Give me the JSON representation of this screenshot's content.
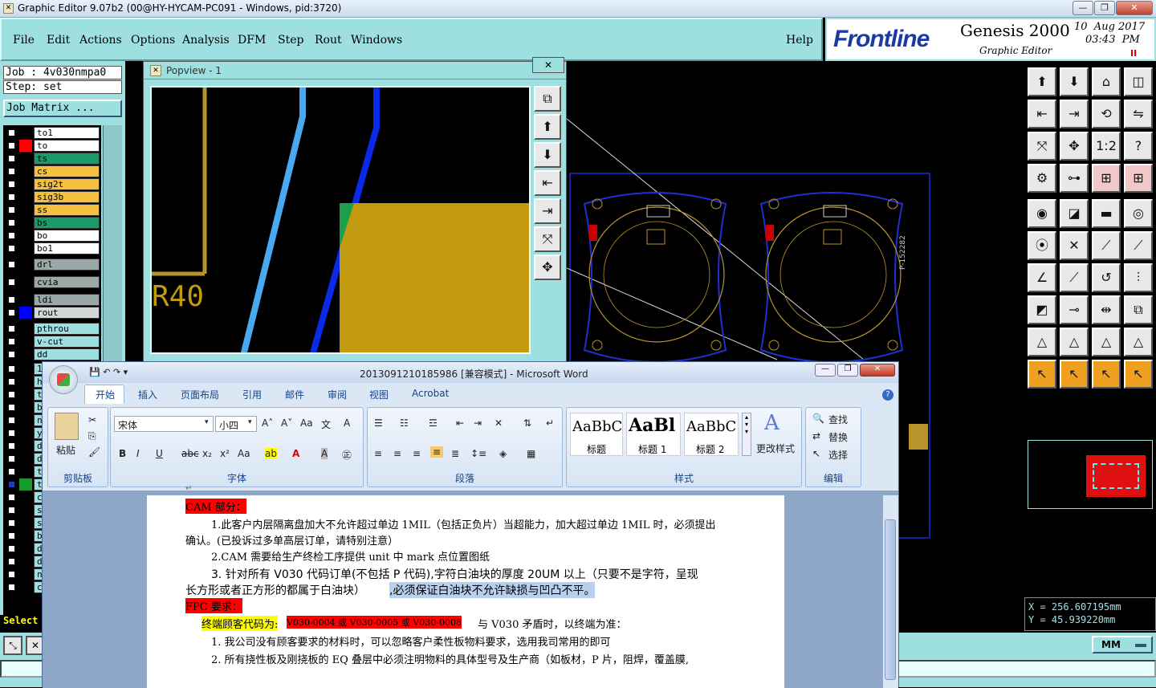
{
  "window": {
    "title": "Graphic Editor 9.07b2 (00@HY-HYCAM-PC091 - Windows, pid:3720)",
    "min": "—",
    "restore": "❐",
    "close": "✕"
  },
  "menu": {
    "items": [
      "File",
      "Edit",
      "Actions",
      "Options",
      "Analysis",
      "DFM",
      "Step",
      "Rout",
      "Windows"
    ],
    "help": "Help"
  },
  "brand": {
    "logo": "Frontline",
    "product": "Genesis 2000",
    "subtitle": "Graphic Editor",
    "date": "10  Aug 2017",
    "time": "03:43  PM",
    "pause": "II"
  },
  "job": {
    "job": "Job : 4v030nmpa0",
    "step": "Step: set",
    "matrix": "Job Matrix ..."
  },
  "layers": [
    {
      "name": "to1",
      "color": "#000000",
      "bg": "#ffffff"
    },
    {
      "name": "to",
      "color": "#ff0000",
      "bg": "#ffffff"
    },
    {
      "name": "ts",
      "color": "#000000",
      "bg": "#1a9a6a"
    },
    {
      "name": "cs",
      "color": "#000000",
      "bg": "#f5c040"
    },
    {
      "name": "sig2t",
      "color": "#000000",
      "bg": "#f5c040"
    },
    {
      "name": "sig3b",
      "color": "#000000",
      "bg": "#f5c040"
    },
    {
      "name": "ss",
      "color": "#000000",
      "bg": "#f5c040"
    },
    {
      "name": "bs",
      "color": "#000000",
      "bg": "#1a9a6a"
    },
    {
      "name": "bo",
      "color": "#000000",
      "bg": "#ffffff"
    },
    {
      "name": "bo1",
      "color": "#000000",
      "bg": "#ffffff"
    },
    {
      "name": "drl",
      "color": "#000000",
      "bg": "#9aa8a8"
    },
    {
      "name": "cvia",
      "color": "#000000",
      "bg": "#9aa8a8"
    },
    {
      "name": "ldi",
      "color": "#000000",
      "bg": "#9aa8a8"
    },
    {
      "name": "rout",
      "color": "#0000ff",
      "bg": "#d0d8d8"
    },
    {
      "name": "pthrou",
      "color": "#000000",
      "bg": "#9ee0e0"
    },
    {
      "name": "v-cut",
      "color": "#000000",
      "bg": "#9ee0e0"
    },
    {
      "name": "dd",
      "color": "#000000",
      "bg": "#9ee0e0"
    }
  ],
  "hidden_layer_letters": [
    "1",
    "h",
    "t",
    "b",
    "n",
    "y",
    "d",
    "d",
    "t",
    "t",
    "c",
    "s",
    "s",
    "b",
    "d",
    "d",
    "n",
    "c"
  ],
  "select_label": "Select",
  "popview": {
    "title": "Popview - 1",
    "close": "✕",
    "r40": "R40"
  },
  "board": {
    "text": "P-152282"
  },
  "coords": {
    "x": "X = 256.607195mm",
    "y": "Y =  45.939220mm"
  },
  "units": "MM",
  "word": {
    "title": "2013091210185986 [兼容模式] - Microsoft Word",
    "tabs": [
      "开始",
      "插入",
      "页面布局",
      "引用",
      "邮件",
      "审阅",
      "视图",
      "Acrobat"
    ],
    "groups": {
      "clipboard": "剪贴板",
      "font": "字体",
      "paragraph": "段落",
      "styles": "样式",
      "editing": "编辑"
    },
    "paste": "粘贴",
    "font_name": "宋体",
    "font_size": "小四",
    "styles": [
      {
        "sample": "AaBbC",
        "name": "标题"
      },
      {
        "sample": "AaBl",
        "name": "标题 1"
      },
      {
        "sample": "AaBbC",
        "name": "标题 2"
      }
    ],
    "change_styles": "更改样式",
    "edit": [
      "查找",
      "替换",
      "选择"
    ],
    "doc": {
      "h1": "CAM 部分：",
      "l1": "1.此客户内层隔离盘加大不允许超过单边 1MIL（包括正负片）当超能力，加大超过单边 1MIL 时，必须提出",
      "l1b": "确认。(已投诉过多单高层订单，请特别注意）",
      "l2": "2.CAM 需要给生产终检工序提供 unit 中 mark 点位置图纸",
      "l3": "3. 针对所有 V030 代码订单(不包括 P 代码),字符白油块的厚度 20UM 以上（只要不是字符，呈现",
      "l3b": "长方形或者正方形的都属于白油块）",
      "l3c": ",必须保证白油块不允许缺损与凹凸不平。",
      "h2": "FPC 要求：",
      "l4a": "终端顾客代码为:",
      "l4b": "V030-0004 或 V030-0005 或 V030-0008",
      "l4c": "与 V030 矛盾时，以终端为准：",
      "l5": "1.  我公司没有顾客要求的材料时，可以忽略客户柔性板物料要求，选用我司常用的即可",
      "l6": "2.  所有挠性板及刚挠板的 EQ 叠层中必须注明物料的具体型号及生产商（如板材，P 片，阻焊，覆盖膜,"
    }
  }
}
